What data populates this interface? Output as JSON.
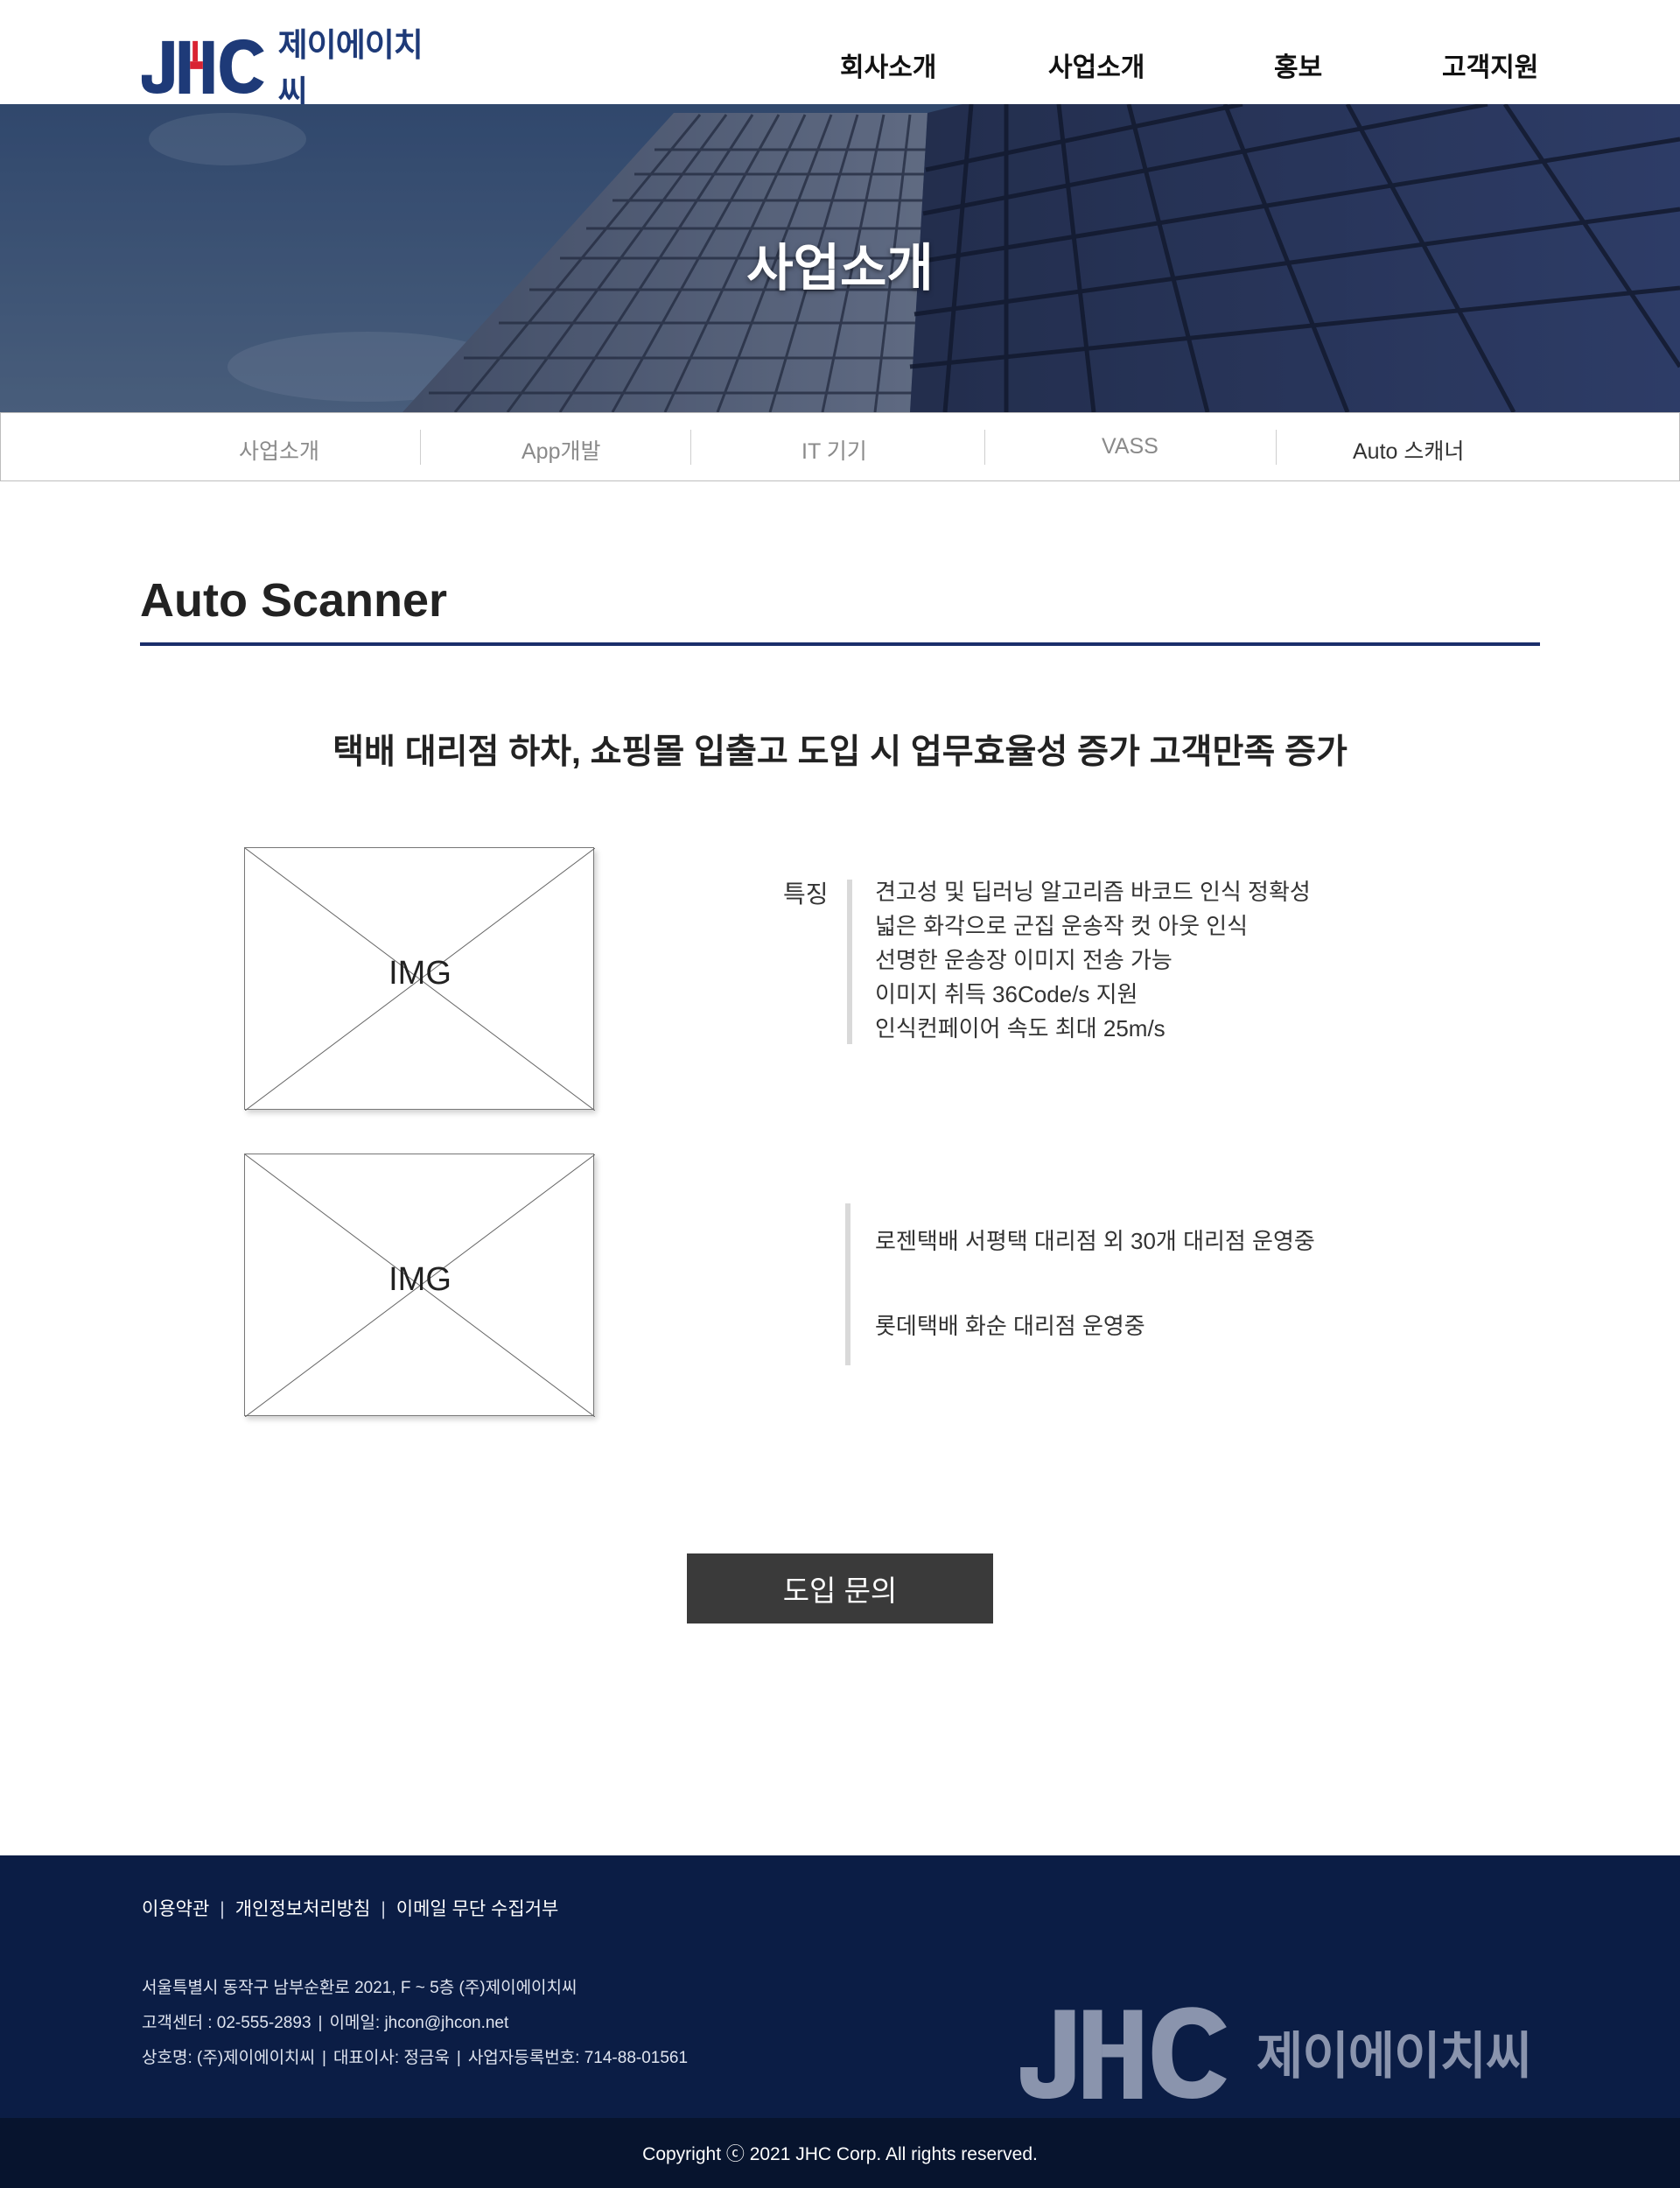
{
  "header": {
    "logo_text": "제이에이치씨",
    "nav": [
      "회사소개",
      "사업소개",
      "홍보",
      "고객지원"
    ]
  },
  "hero": {
    "title": "사업소개"
  },
  "subnav": {
    "items": [
      "사업소개",
      "App개발",
      "IT 기기",
      "VASS",
      "Auto 스캐너"
    ],
    "active": "Auto 스캐너"
  },
  "main": {
    "section_title": "Auto Scanner",
    "headline": "택배 대리점 하차, 쇼핑몰 입출고 도입 시 업무효율성 증가 고객만족 증가",
    "image_placeholder": "IMG",
    "features": {
      "label": "특징",
      "items": [
        "견고성 및 딥러닝 알고리즘 바코드 인식 정확성",
        "넓은 화각으로 군집 운송작 컷 아웃 인식",
        "선명한 운송장 이미지 전송 가능",
        "이미지 취득 36Code/s 지원",
        "인식컨페이어 속도 최대 25m/s"
      ]
    },
    "references": [
      "로젠택배 서평택 대리점 외 30개 대리점 운영중",
      "롯데택배 화순 대리점 운영중"
    ],
    "cta_label": "도입 문의"
  },
  "footer": {
    "links": [
      "이용약관",
      "개인정보처리방침",
      "이메일 무단 수집거부"
    ],
    "address": "서울특별시 동작구 남부순환로 2021, F ~ 5층 (주)제이에이치씨",
    "phone": "고객센터 : 02-555-2893",
    "email": "이메일: jhcon@jhcon.net",
    "company": "상호명: (주)제이에이치씨",
    "ceo": "대표이사: 정금욱",
    "biz_no": "사업자등록번호: 714-88-01561",
    "logo_text": "제이에이치씨",
    "copyright": "Copyright ⓒ 2021 JHC Corp. All rights reserved."
  },
  "colors": {
    "brand_navy": "#1e3a78",
    "brand_red": "#d92332",
    "title_underline": "#1a2e6a",
    "footer_bg": "#0b1d45",
    "copyright_bg": "#07142e",
    "cta_bg": "#3a3a3a"
  }
}
